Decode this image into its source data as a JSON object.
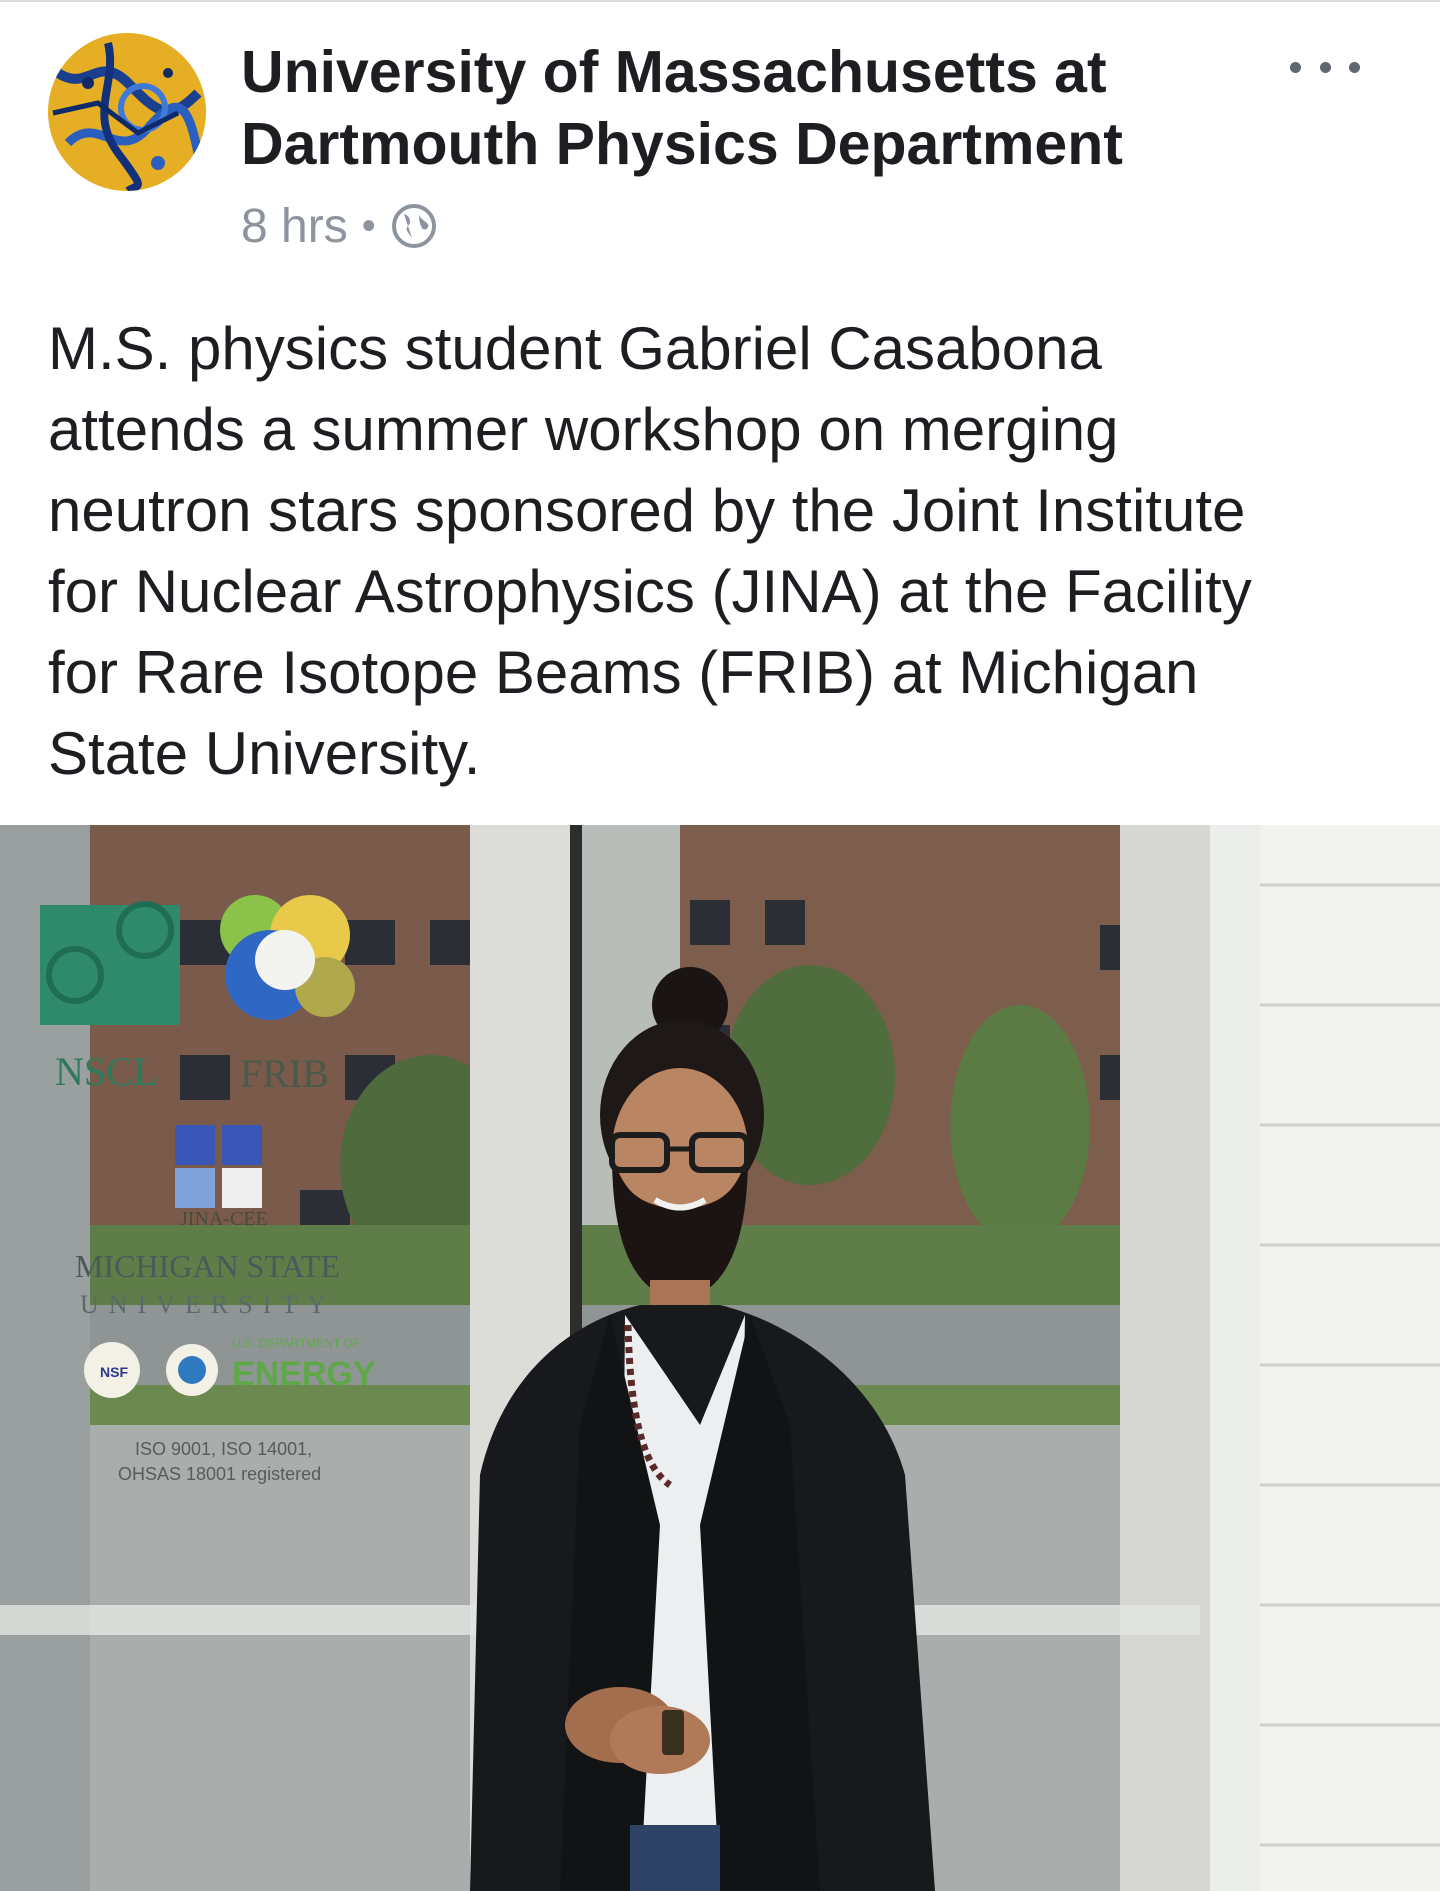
{
  "post": {
    "page_name_line1": "University of Massachusetts at",
    "page_name_line2": "Dartmouth Physics Department",
    "time": "8 hrs",
    "separator": "•",
    "privacy_icon": "globe-icon",
    "more_icon": "more-options-icon",
    "text_lines": [
      "M.S. physics student Gabriel Casabona",
      "attends a summer workshop on merging",
      "neutron stars sponsored by the Joint Institute",
      "for Nuclear Astrophysics (JINA) at the Facility",
      "for Rare Isotope Beams (FRIB) at Michigan",
      "State University."
    ]
  },
  "photo": {
    "door_labels": {
      "nscl": "NSCL",
      "frib": "FRIB",
      "jina": "JINA-CEE",
      "msu_line1": "MICHIGAN STATE",
      "msu_line2": "UNIVERSITY",
      "nsf": "NSF",
      "doe_small": "U.S. DEPARTMENT OF",
      "energy": "ENERGY",
      "iso_line1": "ISO 9001, ISO 14001,",
      "iso_line2": "OHSAS 18001 registered"
    }
  },
  "colors": {
    "name_text": "#1c1e21",
    "meta_text": "#8d949e",
    "body_text": "#1c1e21",
    "energy_green": "#5fa84a"
  }
}
